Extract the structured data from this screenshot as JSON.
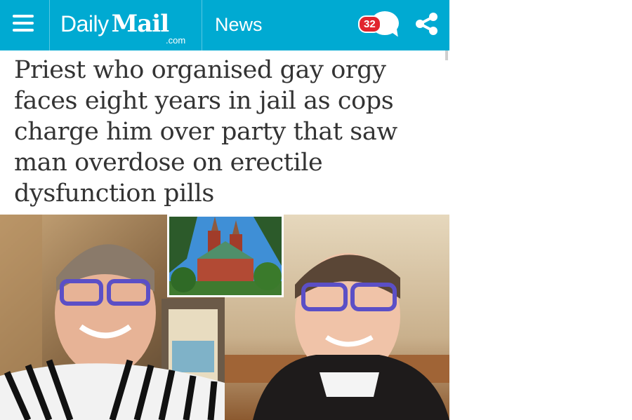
{
  "header": {
    "menu_icon": "hamburger-menu-icon",
    "logo_daily": "Daily",
    "logo_mail": "Mail",
    "logo_com": ".com",
    "section": "News",
    "comment_count": "32",
    "share_icon": "share-icon",
    "colors": {
      "bar": "#00aad2",
      "badge": "#e1252e"
    }
  },
  "article": {
    "headline": "Priest who organised gay orgy faces eight years in jail as cops charge him over party that saw man overdose on erectile dysfunction pills"
  }
}
